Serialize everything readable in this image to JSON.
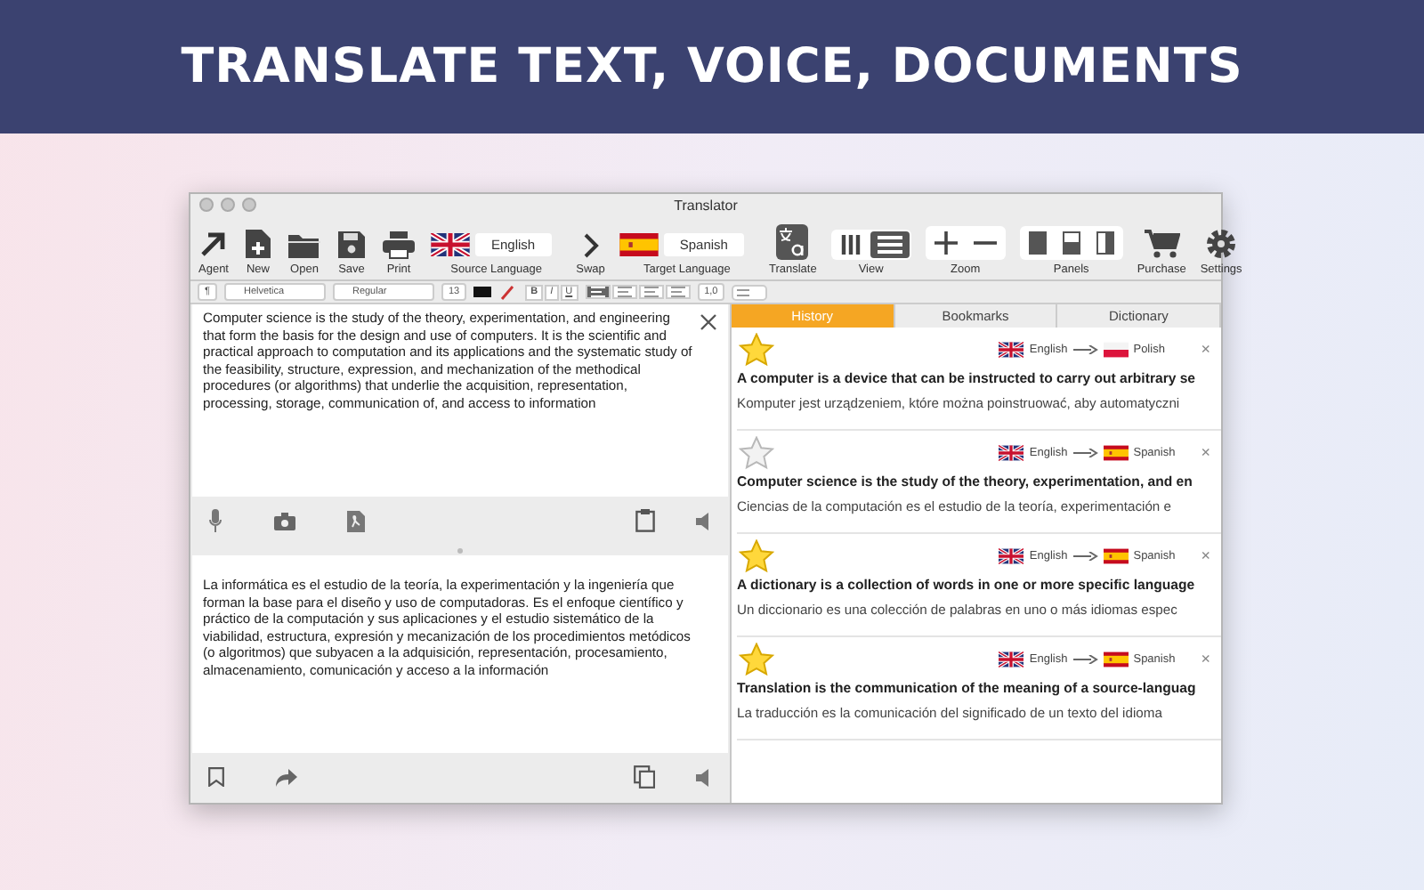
{
  "banner": {
    "title": "TRANSLATE TEXT, VOICE, DOCUMENTS"
  },
  "window": {
    "title": "Translator"
  },
  "toolbar": [
    {
      "kind": "agent",
      "label": "Agent"
    },
    {
      "kind": "new",
      "label": "New"
    },
    {
      "kind": "open",
      "label": "Open"
    },
    {
      "kind": "save",
      "label": "Save"
    },
    {
      "kind": "print",
      "label": "Print"
    },
    {
      "kind": "language",
      "label": "Source Language",
      "language": {
        "kind": "uk",
        "name": "English"
      }
    },
    {
      "kind": "swap",
      "label": "Swap"
    },
    {
      "kind": "language",
      "label": "Target Language",
      "language": {
        "kind": "es",
        "name": "Spanish"
      }
    },
    {
      "kind": "translate",
      "label": "Translate"
    },
    {
      "kind": "view",
      "label": "View",
      "options": [
        {
          "selected": false
        },
        {
          "selected": true
        }
      ]
    },
    {
      "kind": "zoom",
      "label": "Zoom"
    },
    {
      "kind": "panels",
      "label": "Panels"
    },
    {
      "kind": "purchase",
      "label": "Purchase"
    },
    {
      "kind": "settings",
      "label": "Settings"
    }
  ],
  "format_bar": {
    "paragraph": "¶",
    "font": "Helvetica",
    "style": "Regular",
    "size": "13",
    "bold": "B",
    "italic": "I",
    "underline": "U",
    "alignment": [
      {
        "selected": true
      },
      {
        "selected": false
      },
      {
        "selected": false
      },
      {
        "selected": false
      }
    ],
    "line_spacing": "1,0"
  },
  "source": {
    "text": "Computer science is the study of the theory, experimentation, and engineering that form the basis for the design and use of computers. It is the scientific and practical approach to computation and its applications and the systematic study of the feasibility, structure, expression, and mechanization of the methodical procedures (or algorithms) that underlie the acquisition, representation, processing, storage, communication of, and access to information"
  },
  "target": {
    "text": "La informática es el estudio de la teoría, la experimentación y la ingeniería que forman la base para el diseño y uso de computadoras. Es el enfoque científico y práctico de la computación y sus aplicaciones y el estudio sistemático de la viabilidad, estructura, expresión y mecanización de los procedimientos metódicos (o algoritmos) que subyacen a la adquisición, representación, procesamiento, almacenamiento, comunicación y acceso a la información"
  },
  "tabs": [
    {
      "label": "History",
      "selected": true
    },
    {
      "label": "Bookmarks",
      "selected": false
    },
    {
      "label": "Dictionary",
      "selected": false
    }
  ],
  "history": [
    {
      "starred": true,
      "from": {
        "kind": "uk",
        "name": "English"
      },
      "to": {
        "kind": "pl",
        "name": "Polish"
      },
      "close": "×",
      "source": "A computer is a device that can be instructed to carry out arbitrary se",
      "translation": "Komputer jest urządzeniem, które można poinstruować, aby automatyczni"
    },
    {
      "starred": false,
      "from": {
        "kind": "uk",
        "name": "English"
      },
      "to": {
        "kind": "es",
        "name": "Spanish"
      },
      "close": "×",
      "source": "Computer science is the study of the theory, experimentation, and en",
      "translation": "Ciencias de la computación es el estudio de la teoría, experimentación e"
    },
    {
      "starred": true,
      "from": {
        "kind": "uk",
        "name": "English"
      },
      "to": {
        "kind": "es",
        "name": "Spanish"
      },
      "close": "×",
      "source": "A dictionary is a collection of words in one or more specific language",
      "translation": "Un diccionario es una colección de palabras en uno o más idiomas espec"
    },
    {
      "starred": true,
      "from": {
        "kind": "uk",
        "name": "English"
      },
      "to": {
        "kind": "es",
        "name": "Spanish"
      },
      "close": "×",
      "source": "Translation is the communication of the meaning of a source-languag",
      "translation": "La traducción es la comunicación del significado de un texto del idioma"
    }
  ]
}
